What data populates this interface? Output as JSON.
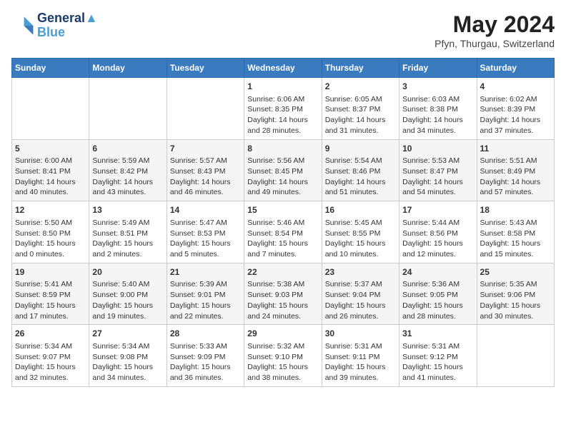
{
  "header": {
    "logo_line1": "General",
    "logo_line2": "Blue",
    "month_year": "May 2024",
    "location": "Pfyn, Thurgau, Switzerland"
  },
  "days_of_week": [
    "Sunday",
    "Monday",
    "Tuesday",
    "Wednesday",
    "Thursday",
    "Friday",
    "Saturday"
  ],
  "weeks": [
    [
      {
        "day": "",
        "info": ""
      },
      {
        "day": "",
        "info": ""
      },
      {
        "day": "",
        "info": ""
      },
      {
        "day": "1",
        "info": "Sunrise: 6:06 AM\nSunset: 8:35 PM\nDaylight: 14 hours\nand 28 minutes."
      },
      {
        "day": "2",
        "info": "Sunrise: 6:05 AM\nSunset: 8:37 PM\nDaylight: 14 hours\nand 31 minutes."
      },
      {
        "day": "3",
        "info": "Sunrise: 6:03 AM\nSunset: 8:38 PM\nDaylight: 14 hours\nand 34 minutes."
      },
      {
        "day": "4",
        "info": "Sunrise: 6:02 AM\nSunset: 8:39 PM\nDaylight: 14 hours\nand 37 minutes."
      }
    ],
    [
      {
        "day": "5",
        "info": "Sunrise: 6:00 AM\nSunset: 8:41 PM\nDaylight: 14 hours\nand 40 minutes."
      },
      {
        "day": "6",
        "info": "Sunrise: 5:59 AM\nSunset: 8:42 PM\nDaylight: 14 hours\nand 43 minutes."
      },
      {
        "day": "7",
        "info": "Sunrise: 5:57 AM\nSunset: 8:43 PM\nDaylight: 14 hours\nand 46 minutes."
      },
      {
        "day": "8",
        "info": "Sunrise: 5:56 AM\nSunset: 8:45 PM\nDaylight: 14 hours\nand 49 minutes."
      },
      {
        "day": "9",
        "info": "Sunrise: 5:54 AM\nSunset: 8:46 PM\nDaylight: 14 hours\nand 51 minutes."
      },
      {
        "day": "10",
        "info": "Sunrise: 5:53 AM\nSunset: 8:47 PM\nDaylight: 14 hours\nand 54 minutes."
      },
      {
        "day": "11",
        "info": "Sunrise: 5:51 AM\nSunset: 8:49 PM\nDaylight: 14 hours\nand 57 minutes."
      }
    ],
    [
      {
        "day": "12",
        "info": "Sunrise: 5:50 AM\nSunset: 8:50 PM\nDaylight: 15 hours\nand 0 minutes."
      },
      {
        "day": "13",
        "info": "Sunrise: 5:49 AM\nSunset: 8:51 PM\nDaylight: 15 hours\nand 2 minutes."
      },
      {
        "day": "14",
        "info": "Sunrise: 5:47 AM\nSunset: 8:53 PM\nDaylight: 15 hours\nand 5 minutes."
      },
      {
        "day": "15",
        "info": "Sunrise: 5:46 AM\nSunset: 8:54 PM\nDaylight: 15 hours\nand 7 minutes."
      },
      {
        "day": "16",
        "info": "Sunrise: 5:45 AM\nSunset: 8:55 PM\nDaylight: 15 hours\nand 10 minutes."
      },
      {
        "day": "17",
        "info": "Sunrise: 5:44 AM\nSunset: 8:56 PM\nDaylight: 15 hours\nand 12 minutes."
      },
      {
        "day": "18",
        "info": "Sunrise: 5:43 AM\nSunset: 8:58 PM\nDaylight: 15 hours\nand 15 minutes."
      }
    ],
    [
      {
        "day": "19",
        "info": "Sunrise: 5:41 AM\nSunset: 8:59 PM\nDaylight: 15 hours\nand 17 minutes."
      },
      {
        "day": "20",
        "info": "Sunrise: 5:40 AM\nSunset: 9:00 PM\nDaylight: 15 hours\nand 19 minutes."
      },
      {
        "day": "21",
        "info": "Sunrise: 5:39 AM\nSunset: 9:01 PM\nDaylight: 15 hours\nand 22 minutes."
      },
      {
        "day": "22",
        "info": "Sunrise: 5:38 AM\nSunset: 9:03 PM\nDaylight: 15 hours\nand 24 minutes."
      },
      {
        "day": "23",
        "info": "Sunrise: 5:37 AM\nSunset: 9:04 PM\nDaylight: 15 hours\nand 26 minutes."
      },
      {
        "day": "24",
        "info": "Sunrise: 5:36 AM\nSunset: 9:05 PM\nDaylight: 15 hours\nand 28 minutes."
      },
      {
        "day": "25",
        "info": "Sunrise: 5:35 AM\nSunset: 9:06 PM\nDaylight: 15 hours\nand 30 minutes."
      }
    ],
    [
      {
        "day": "26",
        "info": "Sunrise: 5:34 AM\nSunset: 9:07 PM\nDaylight: 15 hours\nand 32 minutes."
      },
      {
        "day": "27",
        "info": "Sunrise: 5:34 AM\nSunset: 9:08 PM\nDaylight: 15 hours\nand 34 minutes."
      },
      {
        "day": "28",
        "info": "Sunrise: 5:33 AM\nSunset: 9:09 PM\nDaylight: 15 hours\nand 36 minutes."
      },
      {
        "day": "29",
        "info": "Sunrise: 5:32 AM\nSunset: 9:10 PM\nDaylight: 15 hours\nand 38 minutes."
      },
      {
        "day": "30",
        "info": "Sunrise: 5:31 AM\nSunset: 9:11 PM\nDaylight: 15 hours\nand 39 minutes."
      },
      {
        "day": "31",
        "info": "Sunrise: 5:31 AM\nSunset: 9:12 PM\nDaylight: 15 hours\nand 41 minutes."
      },
      {
        "day": "",
        "info": ""
      }
    ]
  ]
}
